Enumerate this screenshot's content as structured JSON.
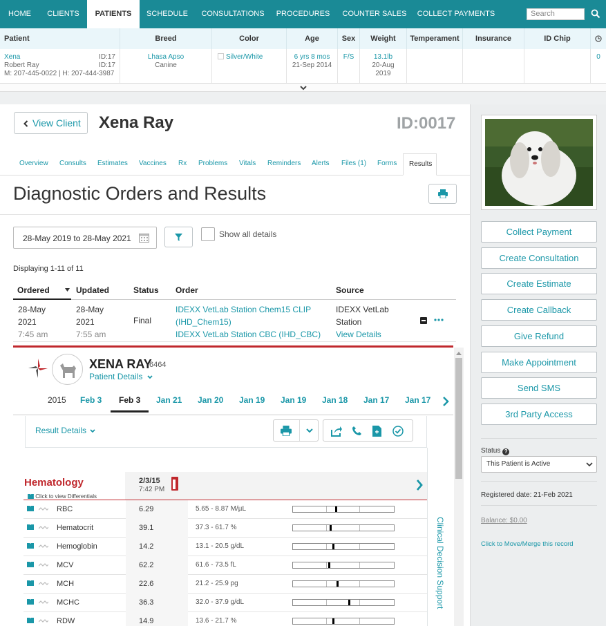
{
  "nav": {
    "items": [
      "HOME",
      "CLIENTS",
      "PATIENTS",
      "SCHEDULE",
      "CONSULTATIONS",
      "PROCEDURES",
      "COUNTER SALES",
      "COLLECT PAYMENTS"
    ],
    "active": "PATIENTS",
    "search_placeholder": "Search"
  },
  "patient_table": {
    "headers": [
      "Patient",
      "Breed",
      "Color",
      "Age",
      "Sex",
      "Weight",
      "Temperament",
      "Insurance",
      "ID Chip"
    ],
    "patient_name": "Xena",
    "patient_id": "ID:17",
    "owner_name": "Robert Ray",
    "owner_id": "ID:17",
    "phones": "M: 207-445-0022 | H: 207-444-3987",
    "breed": "Lhasa Apso",
    "species": "Canine",
    "color": "Silver/White",
    "age": "6 yrs 8 mos",
    "dob": "21-Sep 2014",
    "sex": "F/S",
    "weight": "13.1lb",
    "weight_date_1": "20-Aug",
    "weight_date_2": "2019",
    "count": "0"
  },
  "client": {
    "view_client_label": "View Client",
    "name": "Xena Ray",
    "id": "ID:0017"
  },
  "tabs": [
    "Overview",
    "Consults",
    "Estimates",
    "Vaccines",
    "Rx",
    "Problems",
    "Vitals",
    "Reminders",
    "Alerts",
    "Files (1)",
    "Forms",
    "Results"
  ],
  "page_title": "Diagnostic Orders and Results",
  "filters": {
    "date_range": "28-May 2019 to 28-May 2021",
    "show_all_label": "Show all details"
  },
  "displaying": "Displaying 1-11 of 11",
  "orders_table": {
    "headers": [
      "Ordered",
      "Updated",
      "Status",
      "Order",
      "Source"
    ],
    "row": {
      "ordered_date": "28-May",
      "ordered_year": "2021",
      "ordered_time": "7:45 am",
      "updated_date": "28-May",
      "updated_year": "2021",
      "updated_time": "7:55 am",
      "status": "Final",
      "order_1": "IDEXX VetLab Station Chem15 CLIP",
      "order_1b": "(IHD_Chem15)",
      "order_2": "IDEXX VetLab Station CBC (IHD_CBC)",
      "source_1": "IDEXX VetLab",
      "source_2": "Station",
      "view_details": "View Details"
    }
  },
  "idexx": {
    "patient_name": "XENA RAY",
    "patient_num": "6464",
    "patient_details_label": "Patient Details",
    "year": "2015",
    "dates": [
      "Feb 3",
      "Feb 3",
      "Jan 21",
      "Jan 20",
      "Jan 19",
      "Jan 19",
      "Jan 18",
      "Jan 17",
      "Jan 17"
    ],
    "result_details_label": "Result Details",
    "section": "Hematology",
    "differentials_label": "Click to view Differentials",
    "col_date": "2/3/15",
    "col_time": "7:42 PM",
    "clinical_support_label": "Clinical Decision Support",
    "rows": [
      {
        "name": "RBC",
        "value": "6.29",
        "range": "5.65 - 8.87 M/µL",
        "pos": 0.42
      },
      {
        "name": "Hematocrit",
        "value": "39.1",
        "range": "37.3 - 61.7 %",
        "pos": 0.36
      },
      {
        "name": "Hemoglobin",
        "value": "14.2",
        "range": "13.1 - 20.5 g/dL",
        "pos": 0.39
      },
      {
        "name": "MCV",
        "value": "62.2",
        "range": "61.6 - 73.5 fL",
        "pos": 0.35
      },
      {
        "name": "MCH",
        "value": "22.6",
        "range": "21.2 - 25.9 pg",
        "pos": 0.43
      },
      {
        "name": "MCHC",
        "value": "36.3",
        "range": "32.0 - 37.9 g/dL",
        "pos": 0.55
      },
      {
        "name": "RDW",
        "value": "14.9",
        "range": "13.6 - 21.7 %",
        "pos": 0.39
      }
    ]
  },
  "sidebar": {
    "buttons": [
      "Collect Payment",
      "Create Consultation",
      "Create Estimate",
      "Create Callback",
      "Give Refund",
      "Make Appointment",
      "Send SMS",
      "3rd Party Access"
    ],
    "status_label": "Status",
    "status_value": "This Patient is Active",
    "registered": "Registered date: 21-Feb 2021",
    "balance": "Balance: $0.00",
    "move_merge": "Click to Move/Merge this record"
  },
  "colors": {
    "nav_bg": "#1a8a96",
    "accent": "#1a97a8",
    "hematology_red": "#c0282d"
  }
}
